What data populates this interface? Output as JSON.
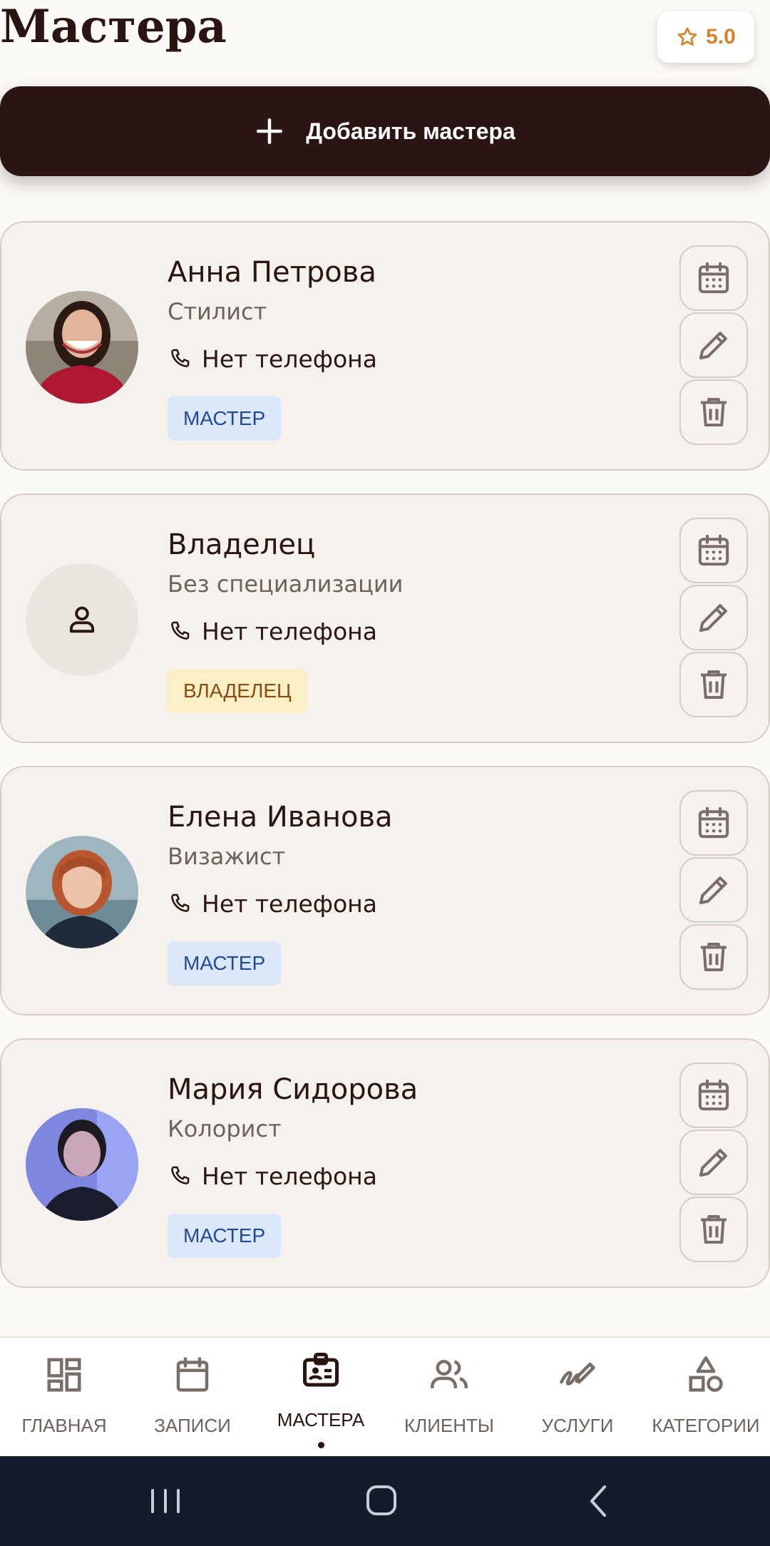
{
  "header": {
    "title": "Мастера",
    "rating": "5.0"
  },
  "add_button": {
    "label": "Добавить мастера"
  },
  "masters": [
    {
      "name": "Анна Петрова",
      "specialization": "Стилист",
      "phone": "Нет телефона",
      "role": "МАСТЕР"
    },
    {
      "name": "Владелец",
      "specialization": "Без специализации",
      "phone": "Нет телефона",
      "role": "ВЛАДЕЛЕЦ"
    },
    {
      "name": "Елена Иванова",
      "specialization": "Визажист",
      "phone": "Нет телефона",
      "role": "МАСТЕР"
    },
    {
      "name": "Мария Сидорова",
      "specialization": "Колорист",
      "phone": "Нет телефона",
      "role": "МАСТЕР"
    }
  ],
  "bottom_nav": {
    "items": [
      {
        "label": "ГЛАВНАЯ",
        "icon": "dashboard-icon"
      },
      {
        "label": "ЗАПИСИ",
        "icon": "calendar-icon"
      },
      {
        "label": "МАСТЕРА",
        "icon": "badge-icon",
        "active": true
      },
      {
        "label": "КЛИЕНТЫ",
        "icon": "people-icon"
      },
      {
        "label": "УСЛУГИ",
        "icon": "signature-icon"
      },
      {
        "label": "КАТЕГОРИИ",
        "icon": "shapes-icon"
      }
    ]
  },
  "colors": {
    "background": "#FCFAF7",
    "primary_dark": "#2A1512",
    "accent_star": "#D9822B",
    "master_badge_bg": "#DCE8F9",
    "owner_badge_bg": "#FCEFC6"
  }
}
